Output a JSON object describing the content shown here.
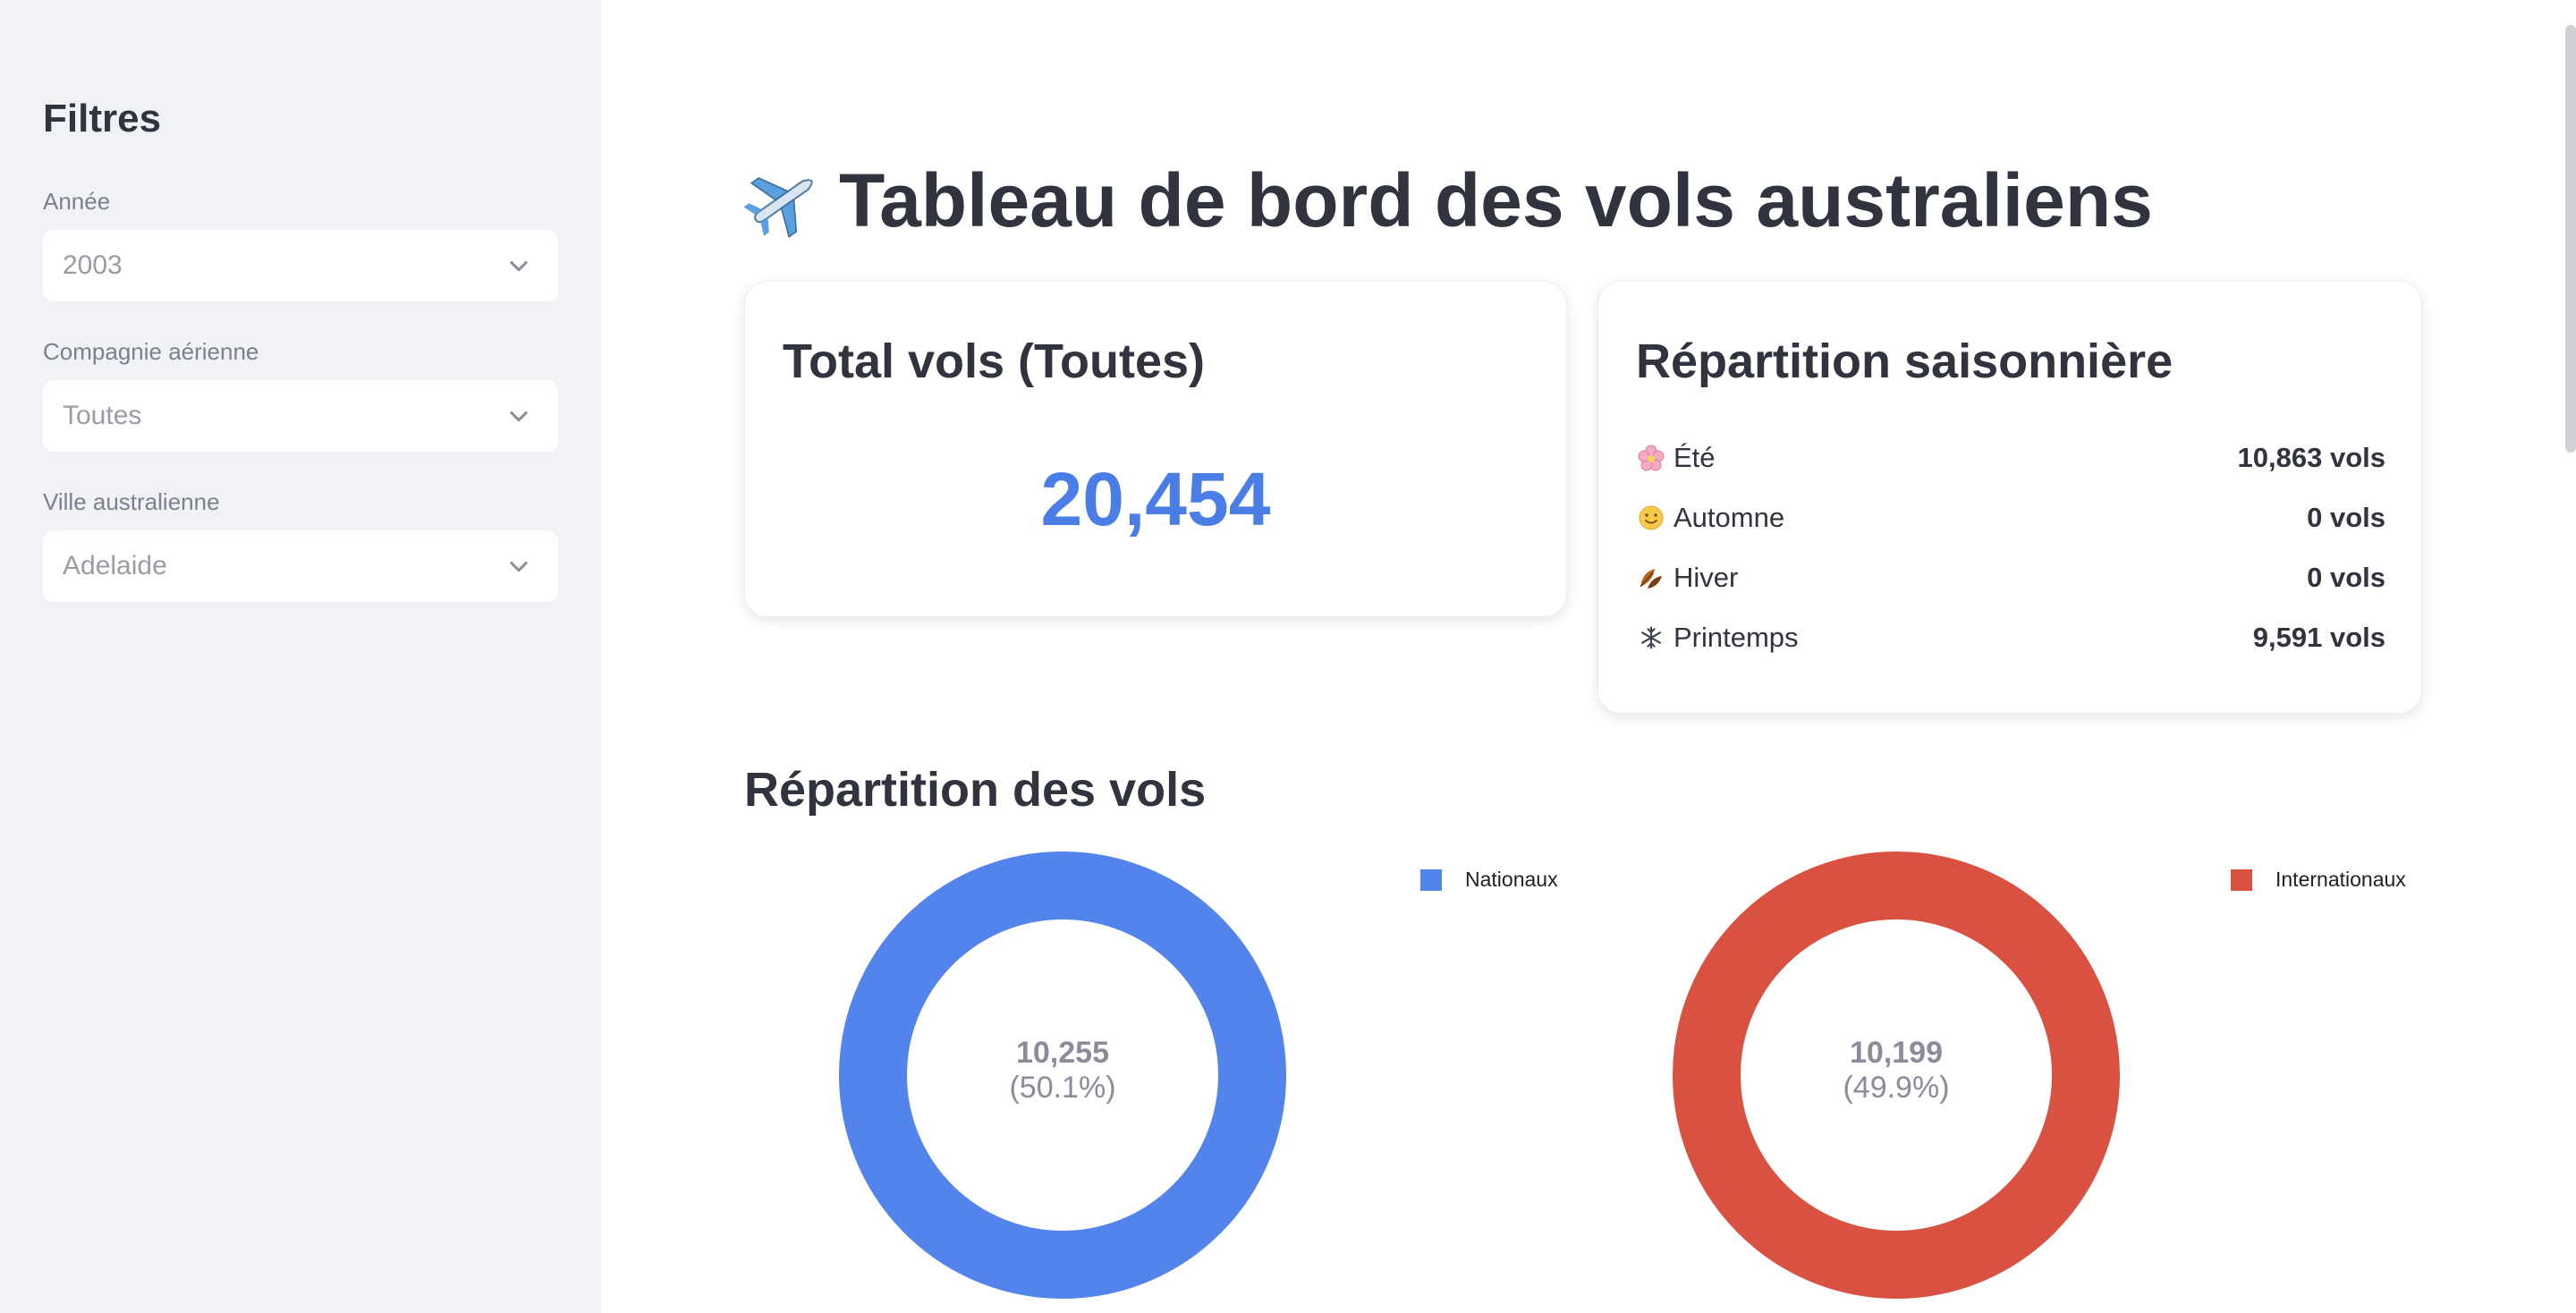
{
  "sidebar": {
    "title": "Filtres",
    "filters": [
      {
        "label": "Année",
        "value": "2003"
      },
      {
        "label": "Compagnie aérienne",
        "value": "Toutes"
      },
      {
        "label": "Ville australienne",
        "value": "Adelaide"
      }
    ]
  },
  "header": {
    "title": "Tableau de bord des vols australiens",
    "icon": "airplane-icon"
  },
  "total_card": {
    "title": "Total vols (Toutes)",
    "value": "20,454",
    "accent": "#4a7ee6"
  },
  "season_card": {
    "title": "Répartition saisonnière",
    "rows": [
      {
        "icon": "cherry-blossom-icon",
        "label": "Été",
        "count": "10,863 vols"
      },
      {
        "icon": "sun-face-icon",
        "label": "Automne",
        "count": "0 vols"
      },
      {
        "icon": "leaves-icon",
        "label": "Hiver",
        "count": "0 vols"
      },
      {
        "icon": "snowflake-icon",
        "label": "Printemps",
        "count": "9,591 vols"
      }
    ]
  },
  "distribution": {
    "title": "Répartition des vols"
  },
  "chart_data": [
    {
      "type": "pie",
      "series": [
        {
          "name": "Nationaux",
          "values": [
            10255
          ]
        }
      ],
      "labels": [
        "Nationaux"
      ],
      "center_value": "10,255",
      "center_pct": "(50.1%)",
      "color": "#5384ec",
      "legend_position": "top-right"
    },
    {
      "type": "pie",
      "series": [
        {
          "name": "Internationaux",
          "values": [
            10199
          ]
        }
      ],
      "labels": [
        "Internationaux"
      ],
      "center_value": "10,199",
      "center_pct": "(49.9%)",
      "color": "#d95140",
      "legend_position": "top-right"
    }
  ]
}
